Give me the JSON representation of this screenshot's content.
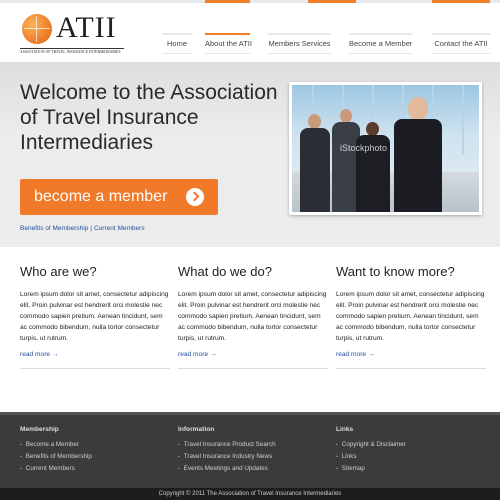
{
  "brand": {
    "logo_text": "ATII",
    "logo_subtitle": "ASSOCIATION OF TRAVEL INSURANCE INTERMEDIARIES",
    "accent_color": "#f07f2a"
  },
  "nav": {
    "items": [
      {
        "label": "Home"
      },
      {
        "label": "About the ATII"
      },
      {
        "label": "Members Services"
      },
      {
        "label": "Become a Member"
      },
      {
        "label": "Contact the  ATII"
      }
    ],
    "active_index": 1
  },
  "hero": {
    "title": "Welcome to the Association of Travel Insurance Intermediaries",
    "cta_label": "become a member",
    "link_benefits": "Benefits of Membership",
    "link_separator": "|",
    "link_members": "Current Members",
    "photo_watermark": "iStockphoto"
  },
  "columns": [
    {
      "heading": "Who are we?",
      "body": "Lorem ipsum dolor sit amet, consectetur adipiscing elit. Proin pulvinar est hendrerit orci molestie nec commodo sapien pretium. Aenean tincidunt, sem ac commodo bibendum, nulla tortor consectetur turpis, ut rutrum.",
      "more": "read more →"
    },
    {
      "heading": "What do we do?",
      "body": "Lorem ipsum dolor sit amet, consectetur adipiscing elit. Proin pulvinar est hendrerit orci molestie nec commodo sapien pretium. Aenean tincidunt, sem ac commodo bibendum, nulla tortor consectetur turpis, ut rutrum.",
      "more": "read more →"
    },
    {
      "heading": "Want to know more?",
      "body": "Lorem ipsum dolor sit amet, consectetur adipiscing elit. Proin pulvinar est hendrerit orci molestie nec commodo sapien pretium. Aenean tincidunt, sem ac commodo bibendum, nulla tortor consectetur turpis, ut rutrum.",
      "more": "read more →"
    }
  ],
  "footer": {
    "membership": {
      "heading": "Membership",
      "items": [
        "Become a Member",
        "Benefits of Membership",
        "Current Members"
      ]
    },
    "information": {
      "heading": "Information",
      "items": [
        "Travel Insurance Product Search",
        "Travel Insurance Industry News",
        "Events Meetings and Updates"
      ]
    },
    "links": {
      "heading": "Links",
      "items": [
        "Copyright & Disclaimer",
        "Links",
        "Sitemap"
      ]
    },
    "copyright": "Copyright © 2011 The Association of Travel Insurance Intermediaries"
  }
}
